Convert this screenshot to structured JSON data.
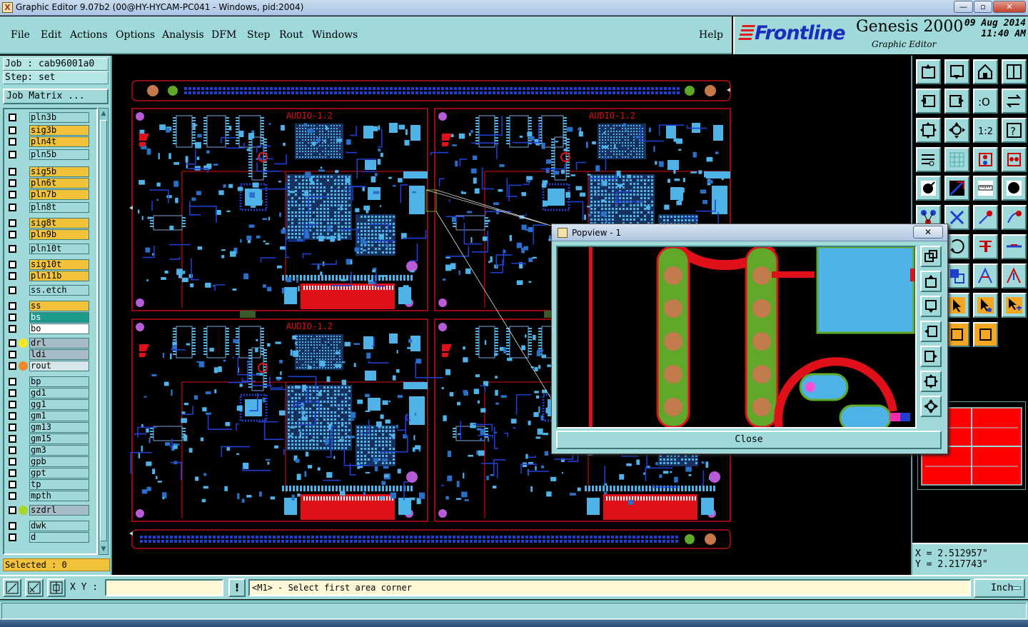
{
  "window": {
    "title": "Graphic Editor 9.07b2 (00@HY-HYCAM-PC041 - Windows, pid:2004)",
    "controls": [
      "—",
      "▫",
      "✕"
    ]
  },
  "menu": [
    "File",
    "Edit",
    "Actions",
    "Options",
    "Analysis",
    "DFM",
    "Step",
    "Rout",
    "Windows"
  ],
  "help": "Help",
  "brand": {
    "logo": "Frontline",
    "product": "Genesis 2000",
    "subtitle": "Graphic Editor",
    "date": "09 Aug 2014",
    "time": "11:40 AM"
  },
  "job": {
    "job_line": "Job : cab96001a0",
    "step_line": "Step: set",
    "matrix_button": "Job Matrix ..."
  },
  "layers": [
    {
      "name": "pln3b",
      "color": "#9fd9d9",
      "dot": ""
    },
    {
      "name": "sig3b",
      "color": "#f1c23a",
      "dot": ""
    },
    {
      "name": "pln4t",
      "color": "#f1c23a",
      "dot": ""
    },
    {
      "name": "pln5b",
      "color": "#9fd9d9",
      "dot": ""
    },
    {
      "name": "sig5b",
      "color": "#f1c23a",
      "dot": ""
    },
    {
      "name": "pln6t",
      "color": "#f1c23a",
      "dot": ""
    },
    {
      "name": "pln7b",
      "color": "#f1c23a",
      "dot": ""
    },
    {
      "name": "pln8t",
      "color": "#9fd9d9",
      "dot": ""
    },
    {
      "name": "sig8t",
      "color": "#f1c23a",
      "dot": ""
    },
    {
      "name": "pln9b",
      "color": "#f1c23a",
      "dot": ""
    },
    {
      "name": "pln10t",
      "color": "#9fd9d9",
      "dot": ""
    },
    {
      "name": "sig10t",
      "color": "#f1c23a",
      "dot": ""
    },
    {
      "name": "pln11b",
      "color": "#f1c23a",
      "dot": ""
    },
    {
      "name": "ss.etch",
      "color": "#9fd9d9",
      "dot": ""
    },
    {
      "name": "ss",
      "color": "#f1c23a",
      "dot": ""
    },
    {
      "name": "bs",
      "color": "#1d9a8a",
      "dot": ""
    },
    {
      "name": "bo",
      "color": "#ffffff",
      "dot": ""
    },
    {
      "name": "drl",
      "color": "#a8bcc8",
      "dot": "#f6e71e"
    },
    {
      "name": "ldi",
      "color": "#a8bcc8",
      "dot": ""
    },
    {
      "name": "rout",
      "color": "#d7e6ea",
      "dot": "#f08a2a"
    },
    {
      "name": "bp",
      "color": "#9fd9d9",
      "dot": ""
    },
    {
      "name": "gd1",
      "color": "#9fd9d9",
      "dot": ""
    },
    {
      "name": "gg1",
      "color": "#9fd9d9",
      "dot": ""
    },
    {
      "name": "gm1",
      "color": "#9fd9d9",
      "dot": ""
    },
    {
      "name": "gm13",
      "color": "#9fd9d9",
      "dot": ""
    },
    {
      "name": "gm15",
      "color": "#9fd9d9",
      "dot": ""
    },
    {
      "name": "gm3",
      "color": "#9fd9d9",
      "dot": ""
    },
    {
      "name": "gpb",
      "color": "#9fd9d9",
      "dot": ""
    },
    {
      "name": "gpt",
      "color": "#9fd9d9",
      "dot": ""
    },
    {
      "name": "tp",
      "color": "#9fd9d9",
      "dot": ""
    },
    {
      "name": "mpth",
      "color": "#9fd9d9",
      "dot": ""
    },
    {
      "name": "szdrl",
      "color": "#a8bcc8",
      "dot": "#a6d82c"
    },
    {
      "name": "dwk",
      "color": "#9fd9d9",
      "dot": ""
    },
    {
      "name": "d",
      "color": "#9fd9d9",
      "dot": ""
    }
  ],
  "selected": "Selected : 0",
  "board": {
    "label": "AUDIO-1.2",
    "colors": {
      "outline": "#e0101a",
      "copper": "#4fb3e8",
      "trace": "#1e3fd0",
      "pad": "#49a0df"
    }
  },
  "popview": {
    "title": "Popview - 1",
    "close_label": "Close",
    "x_label": "✕"
  },
  "coords": {
    "x": "X = 2.512957\"",
    "y": "Y = 2.217743\""
  },
  "bottom": {
    "xy_label": "X Y :",
    "xy_value": "",
    "bang": "!",
    "prompt": "<M1> - Select first area corner",
    "units": "Inch"
  }
}
